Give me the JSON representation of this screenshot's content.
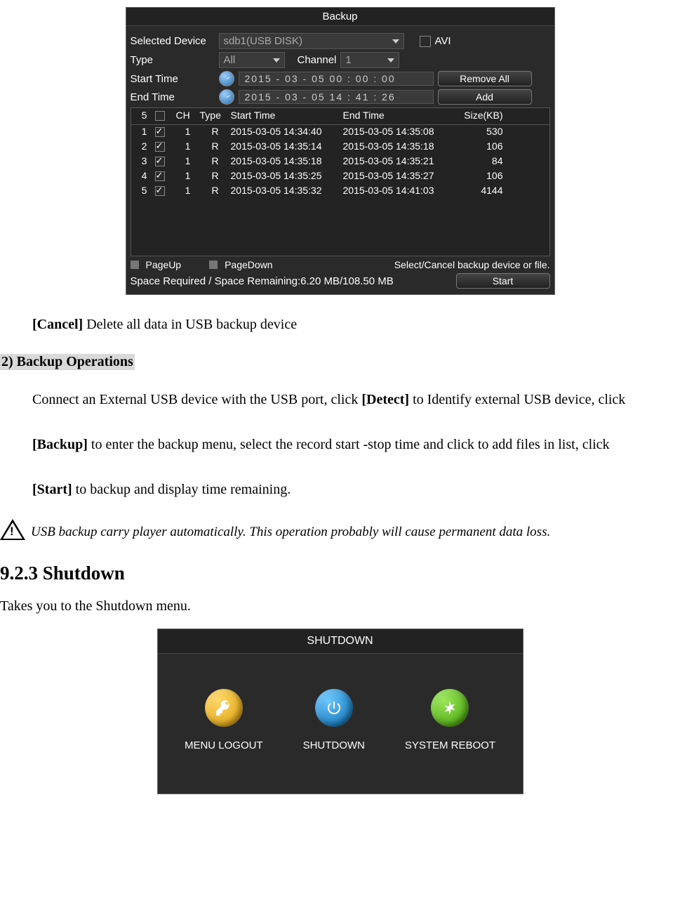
{
  "backup": {
    "title": "Backup",
    "selectedDeviceLabel": "Selected Device",
    "selectedDeviceValue": "sdb1(USB DISK)",
    "aviLabel": "AVI",
    "typeLabel": "Type",
    "typeValue": "All",
    "channelLabel": "Channel",
    "channelValue": "1",
    "startTimeLabel": "Start Time",
    "startTimeValue": "2015  - 03 -  05    00 : 00 :  00",
    "endTimeLabel": "End Time",
    "endTimeValue": "2015  - 03 -  05    14 : 41 :  26",
    "removeAll": "Remove All",
    "add": "Add",
    "columns": {
      "count": "5",
      "ch": "CH",
      "type": "Type",
      "start": "Start Time",
      "end": "End Time",
      "size": "Size(KB)"
    },
    "rows": [
      {
        "idx": "1",
        "checked": true,
        "ch": "1",
        "type": "R",
        "start": "2015-03-05 14:34:40",
        "end": "2015-03-05 14:35:08",
        "size": "530"
      },
      {
        "idx": "2",
        "checked": true,
        "ch": "1",
        "type": "R",
        "start": "2015-03-05 14:35:14",
        "end": "2015-03-05 14:35:18",
        "size": "106"
      },
      {
        "idx": "3",
        "checked": true,
        "ch": "1",
        "type": "R",
        "start": "2015-03-05 14:35:18",
        "end": "2015-03-05 14:35:21",
        "size": "84"
      },
      {
        "idx": "4",
        "checked": true,
        "ch": "1",
        "type": "R",
        "start": "2015-03-05 14:35:25",
        "end": "2015-03-05 14:35:27",
        "size": "106"
      },
      {
        "idx": "5",
        "checked": true,
        "ch": "1",
        "type": "R",
        "start": "2015-03-05 14:35:32",
        "end": "2015-03-05 14:41:03",
        "size": "4144"
      }
    ],
    "pageUp": "PageUp",
    "pageDown": "PageDown",
    "hint": "Select/Cancel backup device or file.",
    "spaceLabel": "Space Required / Space Remaining:",
    "spaceValue": "6.20 MB/108.50 MB",
    "start": "Start"
  },
  "doc": {
    "cancelBold": "[Cancel] ",
    "cancelText": "Delete all data in USB backup device",
    "section2": "2)    Backup Operations",
    "para1a": "Connect an External USB device with the USB port, click ",
    "para1bold1": "[Detect]",
    "para1b": " to Identify external USB device, click ",
    "para2bold": "[Backup]",
    "para2a": " to enter the backup menu, select the record start -stop time and click to add files in list, click ",
    "para3bold": "[Start]",
    "para3a": " to backup and display time remaining.",
    "warnText": "USB backup carry player automatically. This operation probably will cause permanent data loss.",
    "shutdownHeading": "9.2.3  Shutdown",
    "shutdownPara": "Takes you to the Shutdown menu."
  },
  "shutdown": {
    "title": "SHUTDOWN",
    "logout": "MENU LOGOUT",
    "shutdown": "SHUTDOWN",
    "reboot": "SYSTEM REBOOT"
  }
}
